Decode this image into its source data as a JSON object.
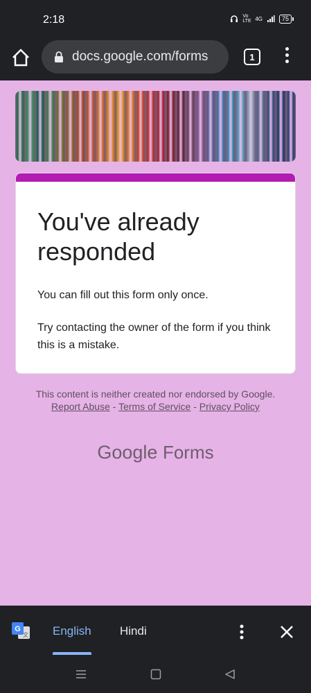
{
  "status": {
    "time": "2:18",
    "network": "4G",
    "volte": "Vo LTE",
    "battery": "75"
  },
  "browser": {
    "url": "docs.google.com/forms",
    "tab_count": "1"
  },
  "banner": {
    "colors": [
      "#1f6b47",
      "#2c8a52",
      "#0f5e4a",
      "#3a7a43",
      "#6e6a2a",
      "#8a5a24",
      "#a2461b",
      "#b9532a",
      "#cc6a1f",
      "#d9821c",
      "#e3921e",
      "#d36f1c",
      "#c5411f",
      "#b82a2a",
      "#a21d2f",
      "#7a1b2b",
      "#5c1e31",
      "#6a3a5d",
      "#7b4f88",
      "#4d5e97",
      "#3b73a8",
      "#2e86b0",
      "#4f96b7",
      "#7fa0b4",
      "#4a6788",
      "#2b4a7a",
      "#1c3365",
      "#2a3d70"
    ]
  },
  "card": {
    "title": "You've already responded",
    "line1": "You can fill out this form only once.",
    "line2": "Try contacting the owner of the form if you think this is a mistake."
  },
  "footer": {
    "text": "This content is neither created nor endorsed by Google.",
    "report_abuse": "Report Abuse",
    "sep1": "-",
    "terms": "Terms of Service",
    "sep2": "-",
    "privacy": "Privacy Policy"
  },
  "brand": {
    "google": "Google",
    "forms": "Forms"
  },
  "translate": {
    "lang1": "English",
    "lang2": "Hindi"
  },
  "colors": {
    "accent": "#b31bb3",
    "background": "#e6b3e6",
    "translate_active": "#8ab4f8"
  }
}
